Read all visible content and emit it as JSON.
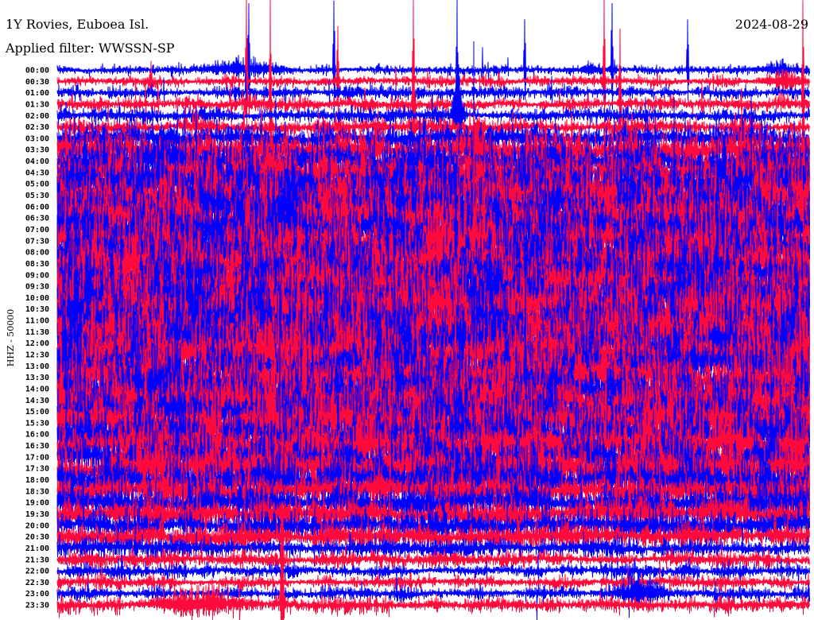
{
  "chart_data": {
    "type": "line",
    "title": "1Y Rovies, Euboea Isl.",
    "date": "2024-08-29",
    "subtitle": "Applied filter: WWSSN-SP",
    "ylabel": "HHZ - 50000",
    "xlim": [
      0,
      30
    ],
    "colors": [
      "#0000ff",
      "#ff0a3c"
    ],
    "lines": [
      {
        "label": "00:00",
        "amplitude": 0.13,
        "events": [
          {
            "minute": 7.5,
            "amplitude": 0.5,
            "duration": 2.2
          },
          {
            "minute": 7.64,
            "amplitude": 3.8,
            "duration": 0.05
          },
          {
            "minute": 11.04,
            "amplitude": 4.0,
            "duration": 0.04
          },
          {
            "minute": 18.65,
            "amplitude": 2.9,
            "duration": 0.04
          },
          {
            "minute": 21.3,
            "amplitude": 0.35,
            "duration": 1.0
          },
          {
            "minute": 22.13,
            "amplitude": 3.9,
            "duration": 0.04
          },
          {
            "minute": 25.15,
            "amplitude": 2.9,
            "duration": 0.04
          },
          {
            "minute": 28.8,
            "amplitude": 0.4,
            "duration": 1.2
          }
        ]
      },
      {
        "label": "00:30",
        "amplitude": 0.15,
        "events": [
          {
            "minute": 3.74,
            "amplitude": 1.2,
            "duration": 0.05
          },
          {
            "minute": 7.55,
            "amplitude": 4.8,
            "duration": 0.05
          },
          {
            "minute": 11.19,
            "amplitude": 3.2,
            "duration": 0.04
          },
          {
            "minute": 21.82,
            "amplitude": 4.8,
            "duration": 0.04
          },
          {
            "minute": 29.0,
            "amplitude": 0.5,
            "duration": 1.3
          }
        ]
      },
      {
        "label": "01:00",
        "amplitude": 0.17,
        "events": [
          {
            "minute": 15.95,
            "amplitude": 5.4,
            "duration": 0.05
          }
        ]
      },
      {
        "label": "01:30",
        "amplitude": 0.19,
        "events": [
          {
            "minute": 8.5,
            "amplitude": 6.0,
            "duration": 0.05
          },
          {
            "minute": 14.21,
            "amplitude": 6.0,
            "duration": 0.06
          },
          {
            "minute": 22.45,
            "amplitude": 4.3,
            "duration": 0.04
          },
          {
            "minute": 29.75,
            "amplitude": 6.0,
            "duration": 0.05
          }
        ]
      },
      {
        "label": "02:00",
        "amplitude": 0.21,
        "events": [
          {
            "minute": 16.0,
            "amplitude": 2.5,
            "duration": 0.3
          }
        ]
      },
      {
        "label": "02:30",
        "amplitude": 0.26
      },
      {
        "label": "03:00",
        "amplitude": 0.4
      },
      {
        "label": "03:30",
        "amplitude": 0.55
      },
      {
        "label": "04:00",
        "amplitude": 0.7
      },
      {
        "label": "04:30",
        "amplitude": 0.8
      },
      {
        "label": "05:00",
        "amplitude": 0.85
      },
      {
        "label": "05:30",
        "amplitude": 0.9
      },
      {
        "label": "06:00",
        "amplitude": 0.9
      },
      {
        "label": "06:30",
        "amplitude": 0.95
      },
      {
        "label": "07:00",
        "amplitude": 1.0
      },
      {
        "label": "07:30",
        "amplitude": 1.0
      },
      {
        "label": "08:00",
        "amplitude": 1.0
      },
      {
        "label": "08:30",
        "amplitude": 1.0
      },
      {
        "label": "09:00",
        "amplitude": 1.0
      },
      {
        "label": "09:30",
        "amplitude": 1.0
      },
      {
        "label": "10:00",
        "amplitude": 1.0
      },
      {
        "label": "10:30",
        "amplitude": 0.95
      },
      {
        "label": "11:00",
        "amplitude": 1.0
      },
      {
        "label": "11:30",
        "amplitude": 1.0
      },
      {
        "label": "12:00",
        "amplitude": 0.95
      },
      {
        "label": "12:30",
        "amplitude": 0.95
      },
      {
        "label": "13:00",
        "amplitude": 0.95
      },
      {
        "label": "13:30",
        "amplitude": 1.0
      },
      {
        "label": "14:00",
        "amplitude": 0.95
      },
      {
        "label": "14:30",
        "amplitude": 0.9
      },
      {
        "label": "15:00",
        "amplitude": 0.9
      },
      {
        "label": "15:30",
        "amplitude": 0.9
      },
      {
        "label": "16:00",
        "amplitude": 0.85
      },
      {
        "label": "16:30",
        "amplitude": 0.85
      },
      {
        "label": "17:00",
        "amplitude": 0.8
      },
      {
        "label": "17:30",
        "amplitude": 0.75
      },
      {
        "label": "18:00",
        "amplitude": 0.7
      },
      {
        "label": "18:30",
        "amplitude": 0.6
      },
      {
        "label": "19:00",
        "amplitude": 0.55
      },
      {
        "label": "19:30",
        "amplitude": 0.5
      },
      {
        "label": "20:00",
        "amplitude": 0.45
      },
      {
        "label": "20:30",
        "amplitude": 0.38,
        "events": [
          {
            "minute": 8.97,
            "amplitude": 2.0,
            "duration": 0.08
          }
        ]
      },
      {
        "label": "21:00",
        "amplitude": 0.26
      },
      {
        "label": "21:30",
        "amplitude": 0.22,
        "events": [
          {
            "minute": 8.97,
            "amplitude": 2.6,
            "duration": 0.08
          }
        ]
      },
      {
        "label": "22:00",
        "amplitude": 0.2
      },
      {
        "label": "22:30",
        "amplitude": 0.17
      },
      {
        "label": "23:00",
        "amplitude": 0.17,
        "events": [
          {
            "minute": 23.3,
            "amplitude": 0.9,
            "duration": 1.2
          }
        ]
      },
      {
        "label": "23:30",
        "amplitude": 0.2,
        "events": [
          {
            "minute": 5.5,
            "amplitude": 0.8,
            "duration": 2.5
          },
          {
            "minute": 8.97,
            "amplitude": 3.5,
            "duration": 0.1
          }
        ]
      }
    ]
  }
}
